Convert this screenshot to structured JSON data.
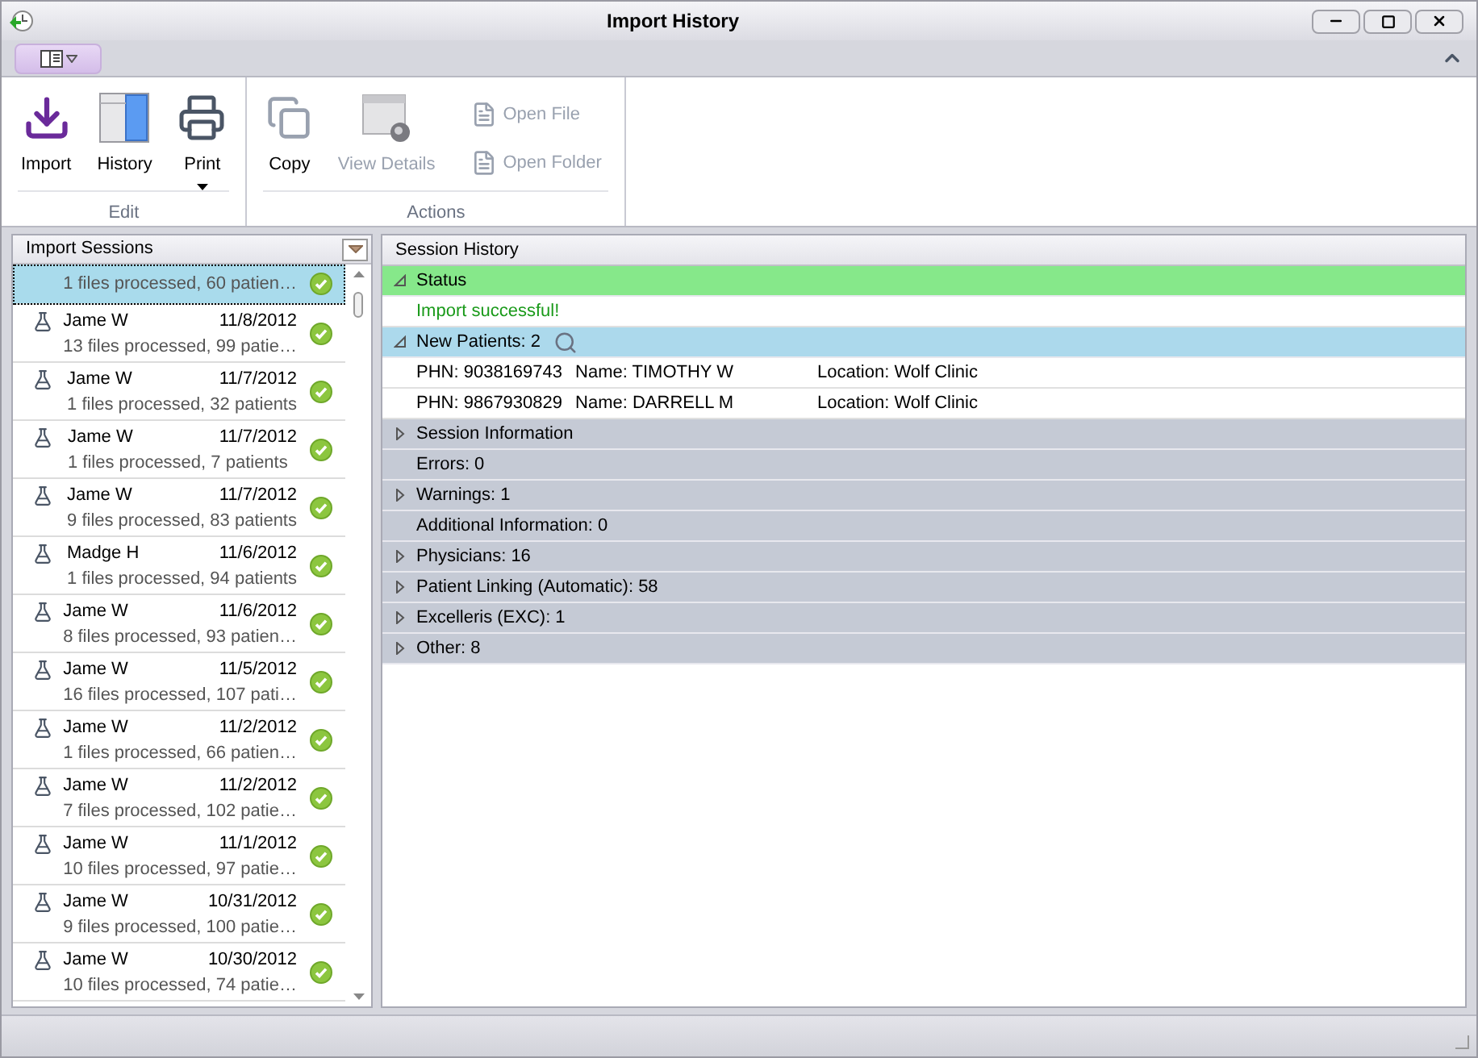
{
  "window": {
    "title": "Import History"
  },
  "ribbon": {
    "groups": [
      {
        "label": "Edit",
        "buttons": [
          {
            "label": "Import",
            "kind": "large",
            "disabled": false,
            "has_menu": false
          },
          {
            "label": "History",
            "kind": "large",
            "disabled": false,
            "has_menu": false
          },
          {
            "label": "Print",
            "kind": "large",
            "disabled": false,
            "has_menu": true
          }
        ]
      },
      {
        "label": "Actions",
        "buttons": [
          {
            "label": "Copy",
            "kind": "large",
            "disabled": false,
            "has_menu": false
          },
          {
            "label": "View Details",
            "kind": "large",
            "disabled": true,
            "has_menu": false
          },
          {
            "label": "Open File",
            "kind": "small",
            "disabled": true,
            "has_menu": false
          },
          {
            "label": "Open Folder",
            "kind": "small",
            "disabled": true,
            "has_menu": false
          }
        ]
      }
    ]
  },
  "sessions": {
    "title": "Import Sessions",
    "items": [
      {
        "summary": "1 files processed, 60 patien…",
        "selected": true
      },
      {
        "name": "Jame W",
        "date": "11/8/2012",
        "summary": "13 files processed, 99 patie…",
        "selected": false
      },
      {
        "name": "Jame W",
        "date": "11/7/2012",
        "summary": "1 files processed, 32 patients",
        "selected": false
      },
      {
        "name": "Jame W",
        "date": "11/7/2012",
        "summary": "1 files processed, 7 patients",
        "selected": false
      },
      {
        "name": "Jame W",
        "date": "11/7/2012",
        "summary": "9 files processed, 83 patients",
        "selected": false
      },
      {
        "name": "Madge H",
        "date": "11/6/2012",
        "summary": "1 files processed, 94 patients",
        "selected": false
      },
      {
        "name": "Jame W",
        "date": "11/6/2012",
        "summary": "8 files processed, 93 patien…",
        "selected": false
      },
      {
        "name": "Jame W",
        "date": "11/5/2012",
        "summary": "16 files processed, 107 pati…",
        "selected": false
      },
      {
        "name": "Jame W",
        "date": "11/2/2012",
        "summary": "1 files processed, 66 patien…",
        "selected": false
      },
      {
        "name": "Jame W",
        "date": "11/2/2012",
        "summary": "7 files processed, 102 patie…",
        "selected": false
      },
      {
        "name": "Jame W",
        "date": "11/1/2012",
        "summary": "10 files processed, 97 patie…",
        "selected": false
      },
      {
        "name": "Jame W",
        "date": "10/31/2012",
        "summary": "9 files processed, 100 patie…",
        "selected": false
      },
      {
        "name": "Jame W",
        "date": "10/30/2012",
        "summary": "10 files processed, 74 patie…",
        "selected": false
      }
    ]
  },
  "history": {
    "title": "Session History",
    "sections": [
      {
        "title": "Status",
        "color": "#86e88a",
        "expandable": true,
        "expanded": true,
        "has_search": false,
        "lines": [
          {
            "kind": "message",
            "text": "Import successful!"
          }
        ]
      },
      {
        "title": "New Patients: 2",
        "color": "#acd9ec",
        "expandable": true,
        "expanded": true,
        "has_search": true,
        "lines": [
          {
            "kind": "patient",
            "phn": "PHN: 9038169743",
            "name": "Name: TIMOTHY W",
            "location": "Location: Wolf Clinic"
          },
          {
            "kind": "patient",
            "phn": "PHN: 9867930829",
            "name": "Name: DARRELL M",
            "location": "Location: Wolf Clinic"
          }
        ]
      },
      {
        "title": "Session Information",
        "color": "#c5cad5",
        "expandable": true,
        "expanded": false,
        "has_search": false
      },
      {
        "title": "Errors: 0",
        "color": "#c5cad5",
        "expandable": false,
        "has_search": false
      },
      {
        "title": "Warnings: 1",
        "color": "#c5cad5",
        "expandable": true,
        "expanded": false,
        "has_search": false
      },
      {
        "title": "Additional Information: 0",
        "color": "#c5cad5",
        "expandable": false,
        "has_search": false
      },
      {
        "title": "Physicians: 16",
        "color": "#c5cad5",
        "expandable": true,
        "expanded": false,
        "has_search": false
      },
      {
        "title": "Patient Linking (Automatic): 58",
        "color": "#c5cad5",
        "expandable": true,
        "expanded": false,
        "has_search": false
      },
      {
        "title": "Excelleris (EXC): 1",
        "color": "#c5cad5",
        "expandable": true,
        "expanded": false,
        "has_search": false
      },
      {
        "title": "Other: 8",
        "color": "#c5cad5",
        "expandable": true,
        "expanded": false,
        "has_search": false
      }
    ]
  }
}
